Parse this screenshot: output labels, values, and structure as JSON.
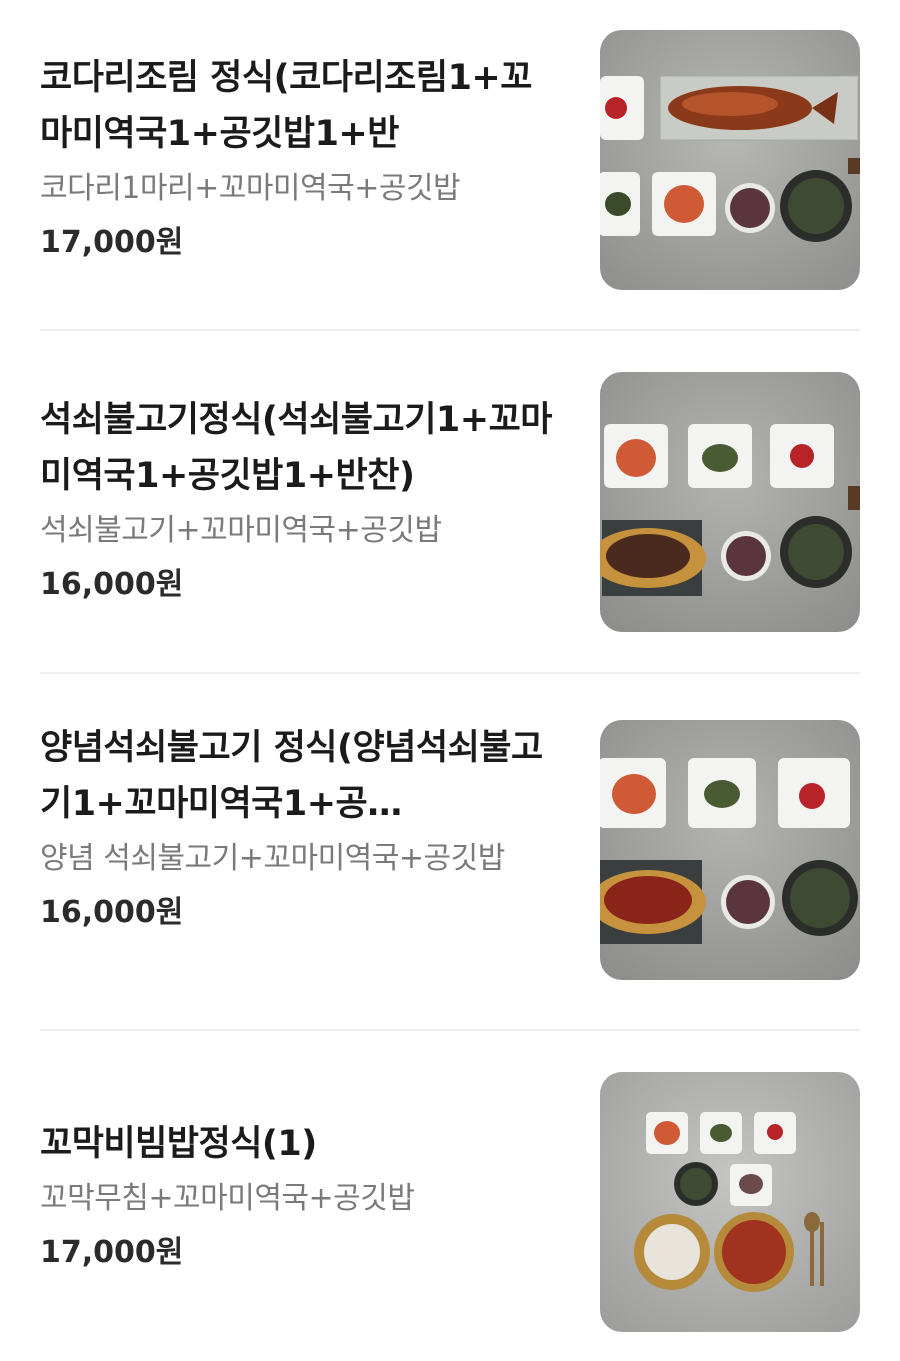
{
  "menu": {
    "items": [
      {
        "name": "코다리조림 정식(코다리조림1+꼬마미역국1+공깃밥1+반",
        "description": "코다리1마리+꼬마미역국+공깃밥",
        "price": "17,000원"
      },
      {
        "name": "석쇠불고기정식(석쇠불고기1+꼬마미역국1+공깃밥1+반찬)",
        "description": "석쇠불고기+꼬마미역국+공깃밥",
        "price": "16,000원"
      },
      {
        "name": "양념석쇠불고기 정식(양념석쇠불고기1+꼬마미역국1+공…",
        "description": "양념 석쇠불고기+꼬마미역국+공깃밥",
        "price": "16,000원"
      },
      {
        "name": "꼬막비빔밥정식(1)",
        "description": "꼬막무침+꼬마미역국+공깃밥",
        "price": "17,000원"
      }
    ]
  }
}
